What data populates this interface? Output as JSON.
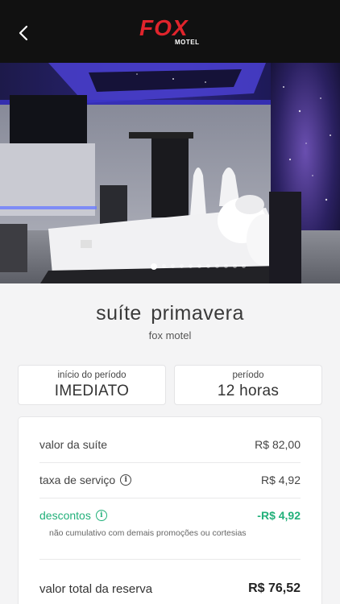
{
  "header": {
    "brand": "FOX",
    "brand_sub": "MOTEL",
    "back_icon": "chevron-left-icon"
  },
  "gallery": {
    "image_count": 11,
    "active_index": 0
  },
  "suite": {
    "name": "suíte  primavera",
    "motel": "fox motel"
  },
  "booking": {
    "start_label": "início do período",
    "start_value": "IMEDIATO",
    "period_label": "período",
    "period_value": "12 horas"
  },
  "summary": {
    "suite_price_label": "valor da suíte",
    "suite_price_value": "R$ 82,00",
    "service_fee_label": "taxa de serviço",
    "service_fee_value": "R$ 4,92",
    "discount_label": "descontos",
    "discount_value": "-R$ 4,92",
    "discount_note": "não cumulativo com demais promoções ou cortesias",
    "total_label": "valor total da reserva",
    "total_value": "R$ 76,52"
  },
  "colors": {
    "brand_red": "#e0242c",
    "discount_green": "#22b07a",
    "header_bg": "#111111"
  }
}
